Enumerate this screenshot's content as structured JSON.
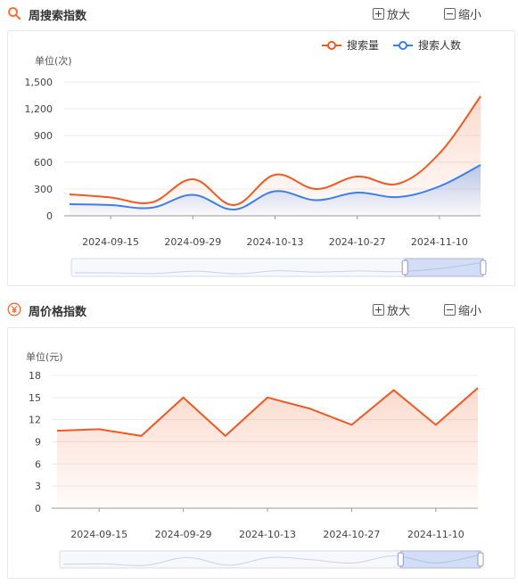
{
  "search_section": {
    "title": "周搜索指数",
    "zoom_in_label": "放大",
    "zoom_out_label": "缩小",
    "icon": "search-icon",
    "accent_color": "#ff6a2c"
  },
  "price_section": {
    "title": "周价格指数",
    "zoom_in_label": "放大",
    "zoom_out_label": "缩小",
    "icon": "yen-icon",
    "accent_color": "#ff6a2c"
  },
  "chart_data": [
    {
      "type": "area",
      "unit_label": "单位(次)",
      "ylim": [
        0,
        1500
      ],
      "yticks": [
        "0",
        "300",
        "600",
        "900",
        "1,200",
        "1,500"
      ],
      "ytick_values": [
        0,
        300,
        600,
        900,
        1200,
        1500
      ],
      "x_tick_labels": [
        "2024-09-15",
        "2024-09-29",
        "2024-10-13",
        "2024-10-27",
        "2024-11-10"
      ],
      "grid": true,
      "legend_position": "top-right",
      "x": [
        "2024-09-08",
        "2024-09-15",
        "2024-09-22",
        "2024-09-29",
        "2024-10-06",
        "2024-10-13",
        "2024-10-20",
        "2024-10-27",
        "2024-11-03",
        "2024-11-10",
        "2024-11-17"
      ],
      "series": [
        {
          "name": "搜索量",
          "color": "#f05a22",
          "values": [
            240,
            205,
            150,
            410,
            120,
            460,
            300,
            440,
            360,
            700,
            1340
          ]
        },
        {
          "name": "搜索人数",
          "color": "#3d7fe8",
          "values": [
            130,
            120,
            90,
            235,
            70,
            275,
            175,
            260,
            210,
            330,
            570
          ]
        }
      ]
    },
    {
      "type": "area",
      "unit_label": "单位(元)",
      "ylim": [
        0,
        18
      ],
      "yticks": [
        "0",
        "3",
        "6",
        "9",
        "12",
        "15",
        "18"
      ],
      "ytick_values": [
        0,
        3,
        6,
        9,
        12,
        15,
        18
      ],
      "x_tick_labels": [
        "2024-09-15",
        "2024-09-29",
        "2024-10-13",
        "2024-10-27",
        "2024-11-10"
      ],
      "grid": true,
      "x": [
        "2024-09-08",
        "2024-09-15",
        "2024-09-22",
        "2024-09-29",
        "2024-10-06",
        "2024-10-13",
        "2024-10-20",
        "2024-10-27",
        "2024-11-03",
        "2024-11-10",
        "2024-11-17"
      ],
      "series": [
        {
          "color": "#f05a22",
          "values": [
            10.5,
            10.7,
            9.8,
            15.0,
            9.8,
            15.0,
            13.5,
            11.3,
            16.0,
            11.3,
            16.3
          ]
        }
      ]
    }
  ]
}
